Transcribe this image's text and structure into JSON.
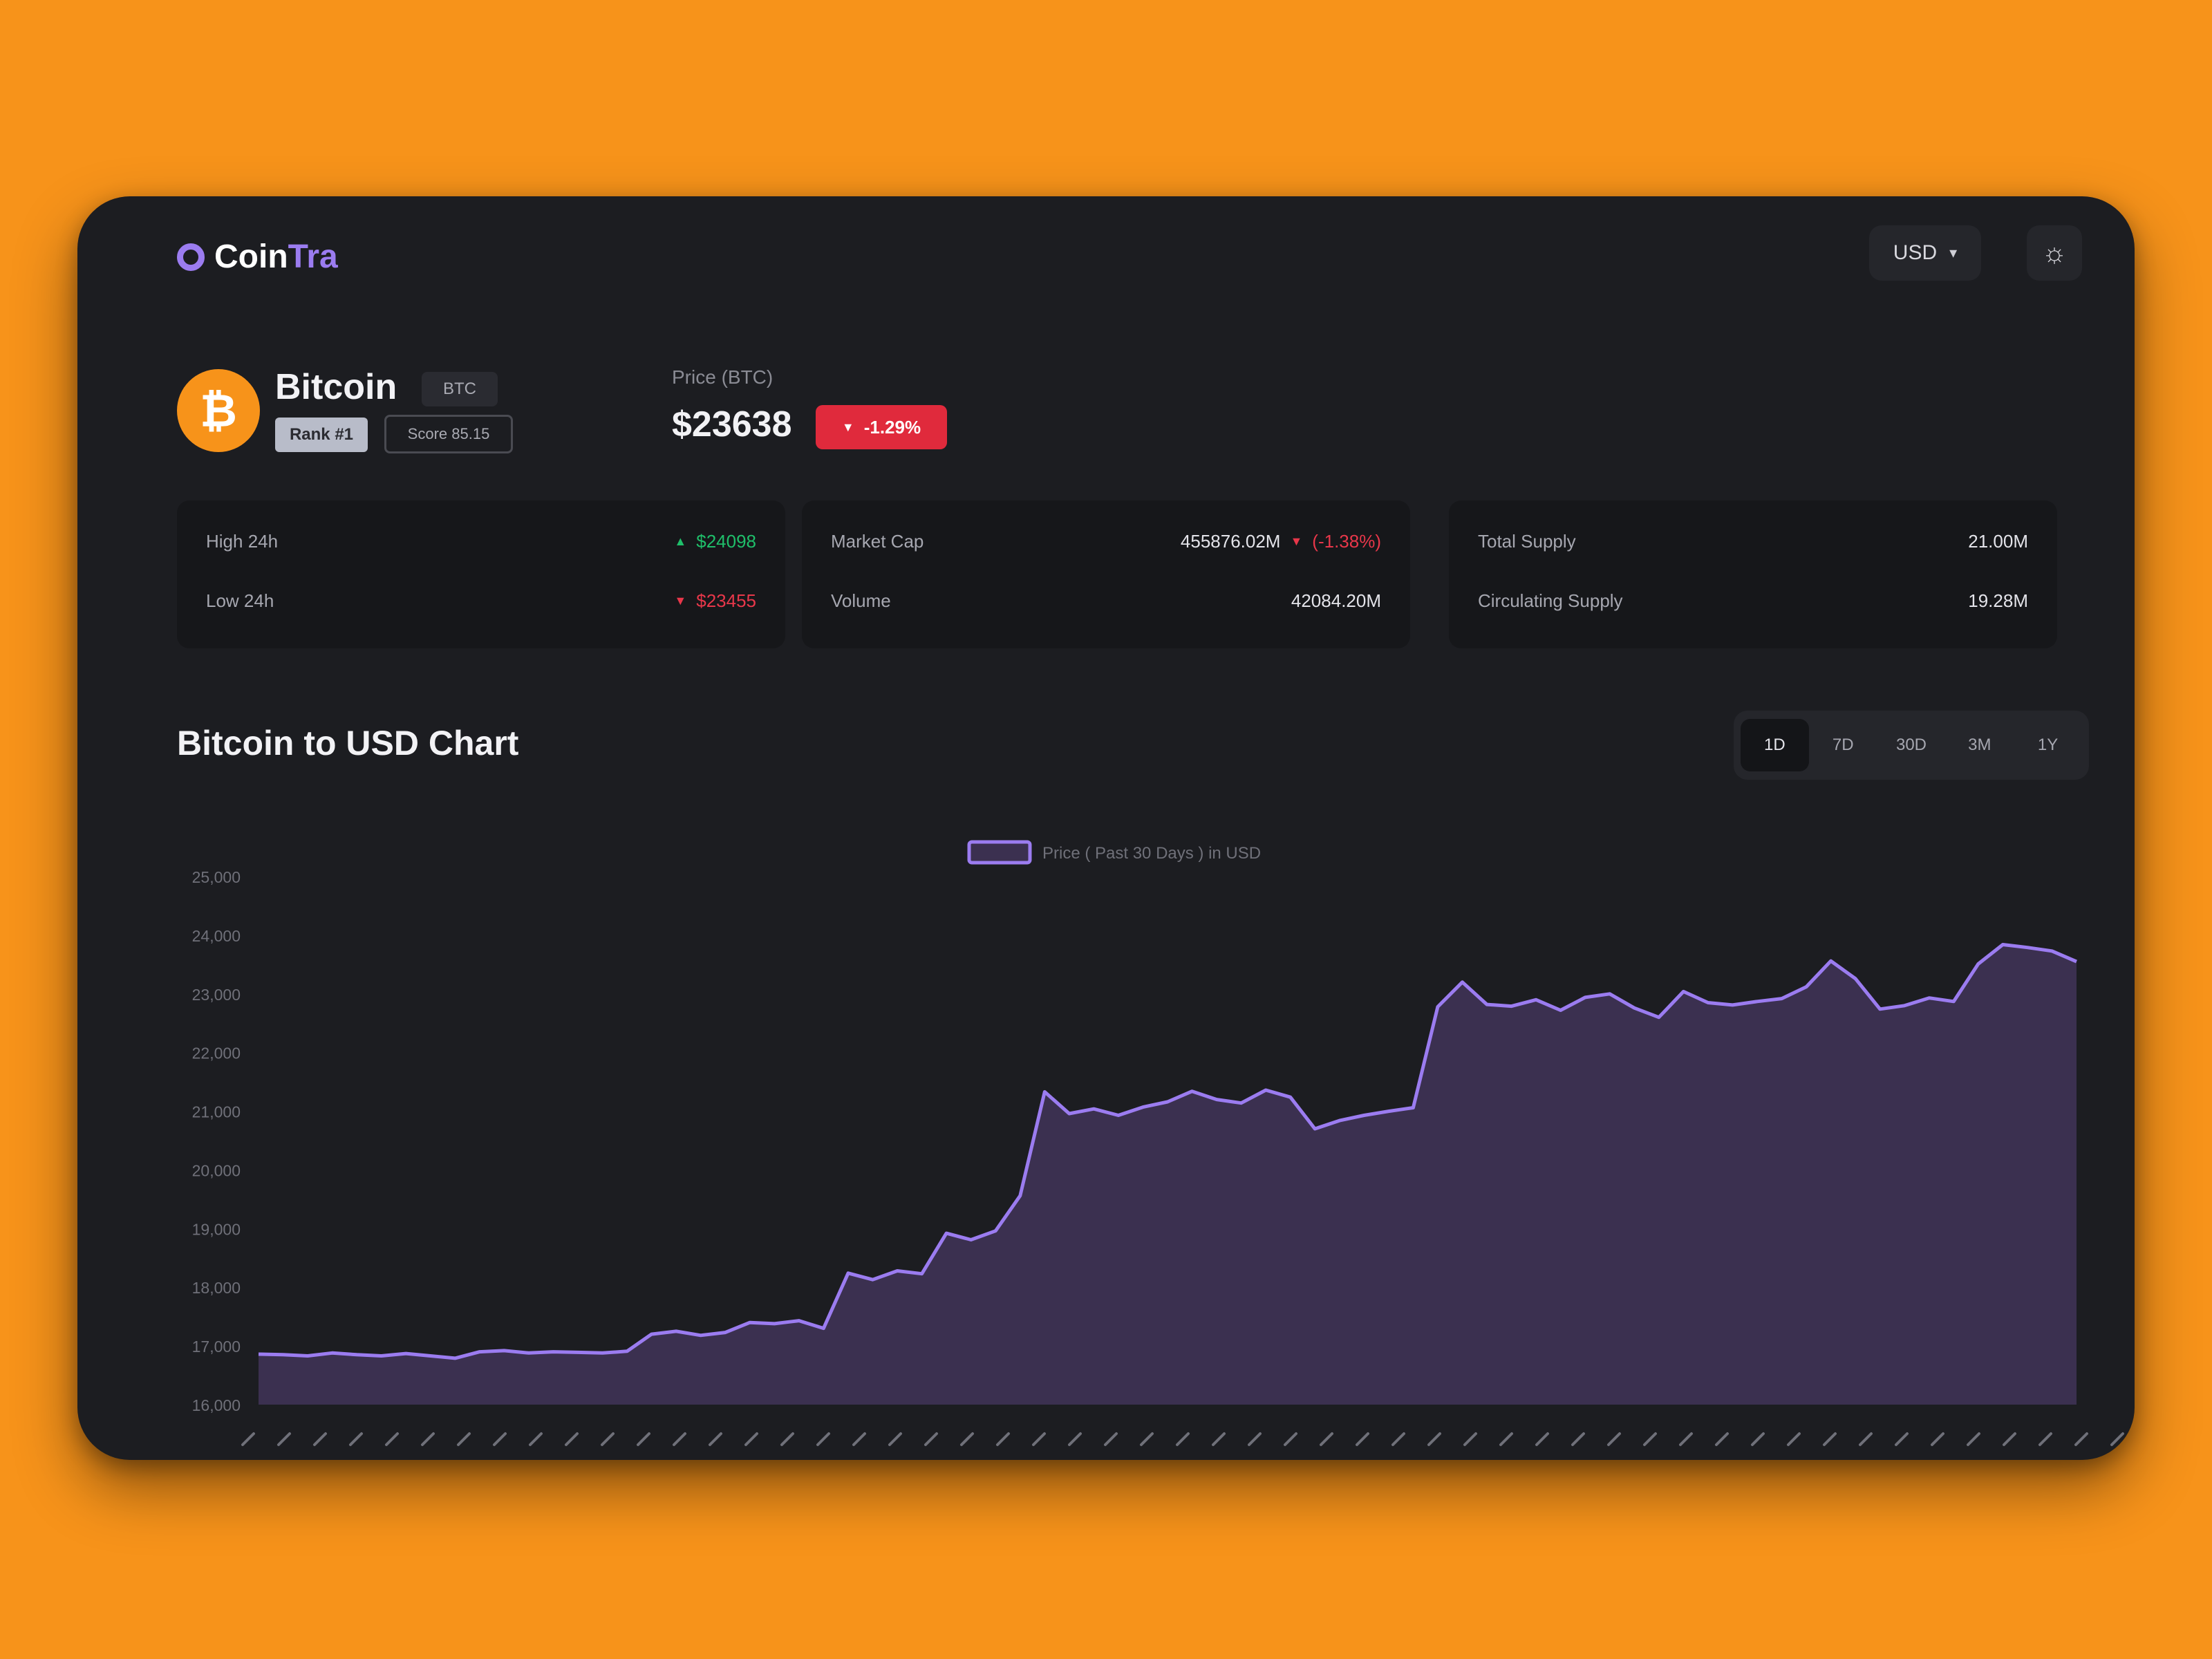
{
  "app": {
    "logo_text": "Coin",
    "logo_accent": "Tra",
    "currency": "USD"
  },
  "icons": {
    "logo": "ring-logo-icon",
    "currency_chevron": "chevron-down-icon",
    "theme": "sun-icon",
    "coin": "bitcoin-icon",
    "change": "triangle-down-icon"
  },
  "coin": {
    "name": "Bitcoin",
    "symbol": "BTC",
    "rank": "Rank #1",
    "score": "Score 85.15",
    "price_label": "Price (BTC)",
    "price": "$23638",
    "change": "-1.29%",
    "icon_glyph": "₿"
  },
  "stats": {
    "high_24h_label": "High 24h",
    "high_24h_value": "$24098",
    "low_24h_label": "Low 24h",
    "low_24h_value": "$23455",
    "market_cap_label": "Market Cap",
    "market_cap_value": "455876.02M",
    "market_cap_change": "(-1.38%)",
    "volume_label": "Volume",
    "volume_value": "42084.20M",
    "total_supply_label": "Total Supply",
    "total_supply_value": "21.00M",
    "circulating_supply_label": "Circulating Supply",
    "circulating_supply_value": "19.28M"
  },
  "chart_section": {
    "title": "Bitcoin to USD Chart",
    "timeframes": [
      "1D",
      "7D",
      "30D",
      "3M",
      "1Y"
    ],
    "active_timeframe": "1D"
  },
  "colors": {
    "accent": "#9b7cf0",
    "area_fill": "#3b3050",
    "positive": "#1fbf6a",
    "negative": "#e02a3c",
    "brand_bitcoin": "#F7931A"
  },
  "chart_data": {
    "type": "area",
    "legend": [
      "Price ( Past 30 Days ) in USD"
    ],
    "legend_position": "top-center",
    "ylim": [
      16000,
      25000
    ],
    "y_ticks": [
      16000,
      17000,
      18000,
      19000,
      20000,
      21000,
      22000,
      23000,
      24000,
      25000
    ],
    "y_tick_labels": [
      "16,000",
      "17,000",
      "18,000",
      "19,000",
      "20,000",
      "21,000",
      "22,000",
      "23,000",
      "24,000",
      "25,000"
    ],
    "x_tick_count": 53,
    "grid": false,
    "series": [
      {
        "name": "Price ( Past 30 Days ) in USD",
        "color": "#9b7cf0",
        "values": [
          16860,
          16850,
          16830,
          16880,
          16850,
          16830,
          16870,
          16830,
          16790,
          16900,
          16920,
          16880,
          16900,
          16890,
          16880,
          16910,
          17200,
          17250,
          17180,
          17230,
          17400,
          17380,
          17430,
          17300,
          18240,
          18130,
          18280,
          18230,
          18920,
          18810,
          18960,
          19560,
          21330,
          20960,
          21040,
          20930,
          21070,
          21160,
          21340,
          21200,
          21140,
          21360,
          21240,
          20700,
          20840,
          20930,
          21000,
          21060,
          22780,
          23200,
          22820,
          22790,
          22900,
          22720,
          22940,
          23000,
          22760,
          22600,
          23040,
          22850,
          22810,
          22870,
          22920,
          23120,
          23560,
          23260,
          22740,
          22800,
          22930,
          22870,
          23510,
          23840,
          23790,
          23730,
          23550
        ]
      }
    ]
  }
}
